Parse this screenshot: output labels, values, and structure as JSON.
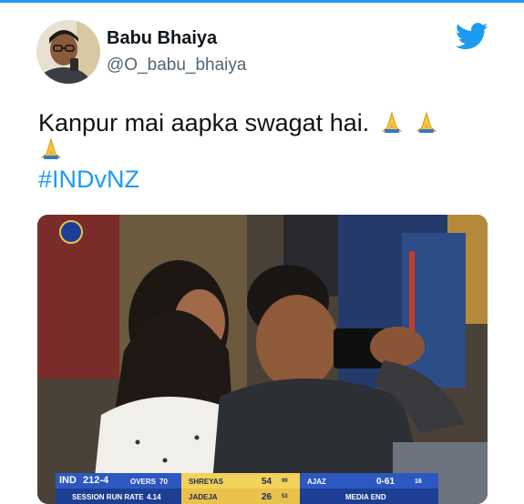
{
  "author": {
    "display_name": "Babu Bhaiya",
    "handle": "@O_babu_bhaiya"
  },
  "tweet": {
    "text": "Kanpur mai aapka swagat hai.",
    "emoji": [
      "folded-hands",
      "folded-hands",
      "folded-hands"
    ],
    "hashtag": "#INDvNZ"
  },
  "icons": {
    "brand": "twitter-bird-icon",
    "channel": "bcci-crest-icon"
  },
  "colors": {
    "accent": "#1d9bf0",
    "scoreboard_blue": "#1c3f94",
    "scoreboard_gold": "#f2d25a"
  },
  "scoreboard": {
    "team": "IND",
    "score": "212-4",
    "overs_label": "OVERS",
    "overs": "70",
    "session_label": "SESSION RUN RATE",
    "session_rate": "4.14",
    "batter1": {
      "name": "SHREYAS",
      "runs": "54",
      "balls": "99"
    },
    "batter2": {
      "name": "JADEJA",
      "runs": "26",
      "balls": "53"
    },
    "bowler": {
      "name": "AJAZ",
      "figures": "0-61",
      "overs": "16"
    },
    "status": "MEDIA END"
  }
}
